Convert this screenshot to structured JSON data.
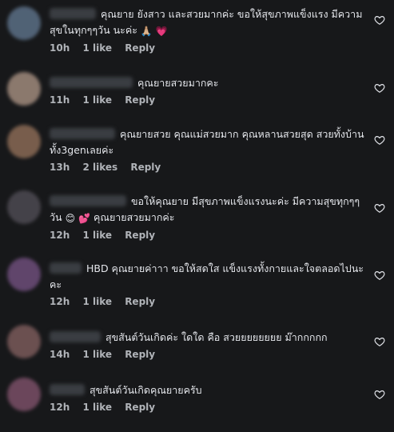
{
  "comments": [
    {
      "text": "คุณยาย ยังสาว และสวยมากค่ะ ขอให้สุขภาพแข็งแรง มีความสุขในทุกๆๆวัน นะค่ะ",
      "emojis": [
        "🙏🏼",
        "💗"
      ],
      "time": "10h",
      "likes": "1 like",
      "reply": "Reply",
      "avatar_color": "#5b6f86"
    },
    {
      "text": "คุณยายสวยมากคะ",
      "emojis": [],
      "time": "11h",
      "likes": "1 like",
      "reply": "Reply",
      "avatar_color": "#a08a7c"
    },
    {
      "text": "คุณยายสวย คุณแม่สวยมาก คุณหลานสวยสุด สวยทั้งบ้านทั้ง3genเลยค่ะ",
      "emojis": [],
      "time": "13h",
      "likes": "2 likes",
      "reply": "Reply",
      "avatar_color": "#8a6a55"
    },
    {
      "text": "ขอให้คุณยาย มีสุขภาพแข็งแรงนะค่ะ มีความสุขทุกๆๆวัน",
      "emojis": [
        "😊",
        "💕"
      ],
      "text2": "คุณยายสวยมากค่ะ",
      "time": "12h",
      "likes": "1 like",
      "reply": "Reply",
      "avatar_color": "#4d4a52"
    },
    {
      "text": "HBD คุณยายค่าาา ขอให้สดใส แข็งแรงทั้งกายและใจตลอดไปนะคะ",
      "emojis": [],
      "time": "12h",
      "likes": "1 like",
      "reply": "Reply",
      "avatar_color": "#6d4d7a"
    },
    {
      "text": "สุขสันต์วันเกิดค่ะ ใดใด คือ สวยยยยยยยย ม๊ากกกกก",
      "emojis": [],
      "time": "14h",
      "likes": "1 like",
      "reply": "Reply",
      "avatar_color": "#7a5a5a"
    },
    {
      "text": "สุขสันต์วันเกิดคุณยายครับ",
      "emojis": [],
      "time": "12h",
      "likes": "1 like",
      "reply": "Reply",
      "avatar_color": "#7a4f67"
    }
  ]
}
